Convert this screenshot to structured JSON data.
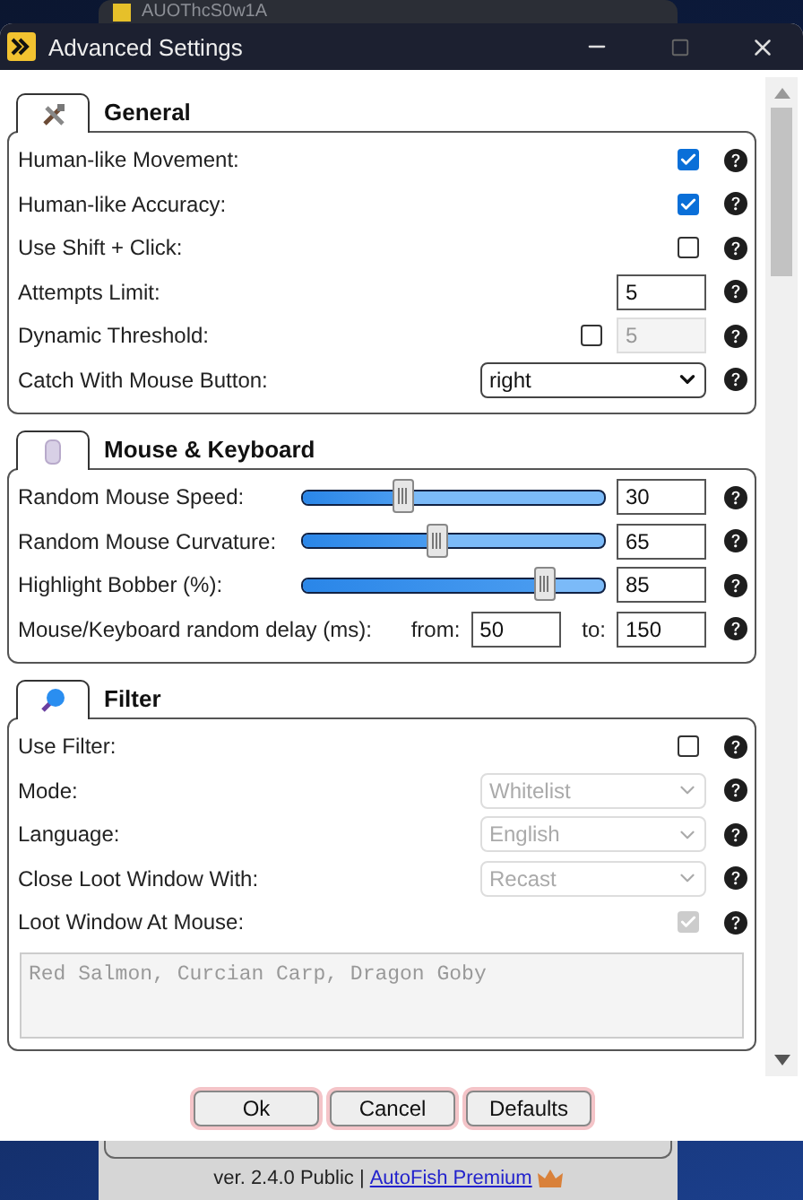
{
  "back_window": {
    "title": "AUOThcS0w1A",
    "footer_text": "ver. 2.4.0 Public |",
    "footer_link": "AutoFish Premium"
  },
  "window": {
    "title": "Advanced Settings"
  },
  "sections": [
    {
      "title": "General",
      "rows": [
        {
          "kind": "checkbox",
          "label": "Human-like Movement:",
          "checked": true,
          "disabled": false
        },
        {
          "kind": "checkbox",
          "label": "Human-like Accuracy:",
          "checked": true,
          "disabled": false
        },
        {
          "kind": "checkbox",
          "label": "Use Shift + Click:",
          "checked": false,
          "disabled": false
        },
        {
          "kind": "number",
          "label": "Attempts Limit:",
          "value": "5"
        },
        {
          "kind": "check_number",
          "label": "Dynamic Threshold:",
          "checked": false,
          "value": "5"
        },
        {
          "kind": "select",
          "label": "Catch With Mouse Button:",
          "value": "right",
          "disabled": false
        }
      ]
    },
    {
      "title": "Mouse & Keyboard",
      "rows": [
        {
          "kind": "slider",
          "label": "Random Mouse Speed:",
          "level": 0.32,
          "value": "30"
        },
        {
          "kind": "slider",
          "label": "Random Mouse Curvature:",
          "level": 0.44,
          "value": "65"
        },
        {
          "kind": "slider",
          "label": "Highlight Bobber (%):",
          "level": 0.82,
          "value": "85"
        },
        {
          "kind": "range",
          "label": "Mouse/Keyboard random delay (ms):",
          "from_label": "from:",
          "from": "50",
          "to_label": "to:",
          "to": "150"
        }
      ]
    },
    {
      "title": "Filter",
      "rows": [
        {
          "kind": "checkbox",
          "label": "Use Filter:",
          "checked": false,
          "disabled": false
        },
        {
          "kind": "select",
          "label": "Mode:",
          "value": "Whitelist",
          "disabled": true
        },
        {
          "kind": "select",
          "label": "Language:",
          "value": "English",
          "disabled": true
        },
        {
          "kind": "select",
          "label": "Close Loot Window With:",
          "value": "Recast",
          "disabled": true
        },
        {
          "kind": "checkbox",
          "label": "Loot Window At Mouse:",
          "checked": true,
          "disabled": true
        },
        {
          "kind": "textarea",
          "value": "Red Salmon, Curcian Carp, Dragon Goby",
          "disabled": true
        }
      ]
    }
  ],
  "buttons": [
    {
      "label": "Ok"
    },
    {
      "label": "Cancel"
    },
    {
      "label": "Defaults"
    }
  ]
}
